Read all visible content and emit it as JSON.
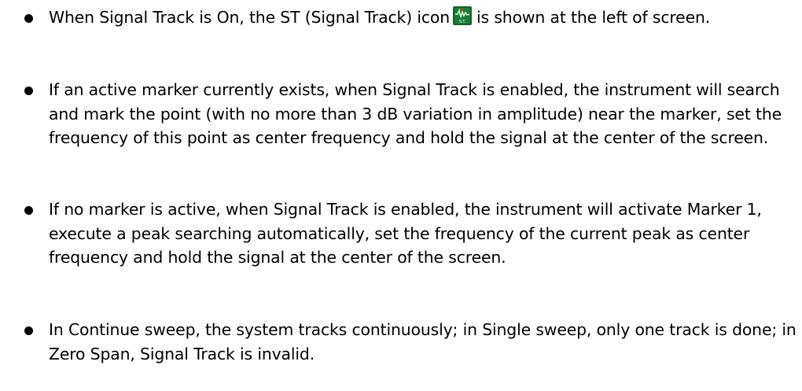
{
  "bullets": [
    {
      "before_icon": "When Signal Track is On, the ST (Signal Track) icon",
      "icon": "signal-track-icon",
      "icon_label": "S.T.",
      "after_icon": "is shown at the left of screen."
    },
    {
      "text": "If an active marker currently exists, when Signal Track is enabled, the instrument will search and mark the point (with no more than 3 dB variation in amplitude) near the marker, set the frequency of this point as center frequency and hold the signal at the center of the screen."
    },
    {
      "text": "If no marker is active, when Signal Track is enabled, the instrument will activate Marker 1, execute a peak searching automatically, set the frequency of the current peak as center frequency and hold the signal at the center of the screen."
    },
    {
      "text": "In Continue sweep, the system tracks continuously; in Single sweep, only one track is done; in Zero Span, Signal Track is invalid."
    }
  ],
  "colors": {
    "icon_background": "#1c7a3a",
    "icon_trace": "#d8ffd0",
    "icon_marker": "#e03020"
  }
}
